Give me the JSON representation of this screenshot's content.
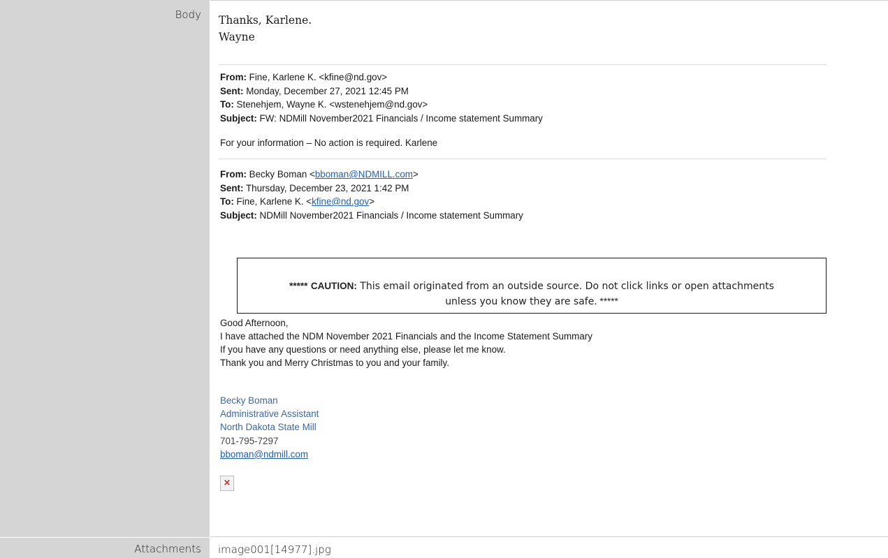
{
  "fields": {
    "body_label": "Body",
    "attachments_label": "Attachments"
  },
  "greeting": {
    "line1": "Thanks, Karlene.",
    "line2": "Wayne"
  },
  "forward": {
    "from_label": "From:",
    "from_value": " Fine, Karlene K. <kfine@nd.gov>",
    "sent_label": "Sent:",
    "sent_value": " Monday, December 27, 2021 12:45 PM",
    "to_label": "To:",
    "to_value": " Stenehjem, Wayne K. <wstenehjem@nd.gov>",
    "subject_label": "Subject:",
    "subject_value": " FW: NDMill November2021 Financials / Income statement Summary",
    "note": "For your information – No action is required.   Karlene"
  },
  "original": {
    "from_label": "From:",
    "from_name": " Becky Boman <",
    "from_email": "bboman@NDMILL.com",
    "from_close": ">",
    "sent_label": "Sent:",
    "sent_value": " Thursday, December 23, 2021 1:42 PM",
    "to_label": "To:",
    "to_name": " Fine, Karlene K. <",
    "to_email": "kfine@nd.gov",
    "to_close": ">",
    "subject_label": "Subject:",
    "subject_value": " NDMill November2021 Financials / Income statement Summary"
  },
  "caution": {
    "prefix": "*****",
    "keyword": "CAUTION:",
    "line1": " This email originated from an outside source. Do not click links or open attachments",
    "line2": "unless you know they are safe.",
    "suffix": " *****"
  },
  "message": {
    "line1": "Good Afternoon,",
    "line2": "I have attached the NDM November 2021 Financials and the Income Statement Summary",
    "line3": "If you have any questions or need anything else, please let me know.",
    "line4": "Thank you and Merry Christmas to you and your family."
  },
  "signature": {
    "name": "Becky Boman",
    "title": "Administrative Assistant",
    "org": "North Dakota State Mill",
    "phone": "701-795-7297",
    "email": "bboman@ndmill.com"
  },
  "attachments": {
    "file": "image001[14977].jpg"
  },
  "icons": {
    "broken_image": "broken-image-icon",
    "broken_image_glyph": "×"
  }
}
